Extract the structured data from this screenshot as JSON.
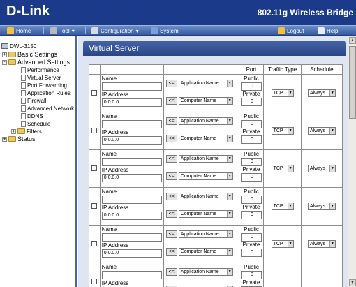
{
  "header": {
    "logo": "D-Link",
    "product": "802.11g Wireless Bridge"
  },
  "menu": {
    "home": "Home",
    "tool": "Tool",
    "configuration": "Configuration",
    "system": "System",
    "logout": "Logout",
    "help": "Help"
  },
  "tree": {
    "root": "DWL-3150",
    "basic": "Basic Settings",
    "advanced": "Advanced Settings",
    "items": [
      "Performance",
      "Virtual Server",
      "Port Forwarding",
      "Application Rules",
      "Firewall",
      "Advanced Network",
      "DDNS",
      "Schedule"
    ],
    "filters": "Filters",
    "status": "Status"
  },
  "main": {
    "title": "Virtual Server",
    "headers": {
      "port": "Port",
      "traffic": "Traffic Type",
      "schedule": "Schedule"
    },
    "labels": {
      "name": "Name",
      "ip": "IP Address",
      "public": "Public",
      "private": "Private",
      "copy": "<<",
      "app_name": "Application Name",
      "computer_name": "Computer Name"
    },
    "rows": [
      {
        "name": "",
        "ip": "0.0.0.0",
        "public": "0",
        "private": "0",
        "traffic": "TCP",
        "schedule": "Always"
      },
      {
        "name": "",
        "ip": "0.0.0.0",
        "public": "0",
        "private": "0",
        "traffic": "TCP",
        "schedule": "Always"
      },
      {
        "name": "",
        "ip": "0.0.0.0",
        "public": "0",
        "private": "0",
        "traffic": "TCP",
        "schedule": "Always"
      },
      {
        "name": "",
        "ip": "0.0.0.0",
        "public": "0",
        "private": "0",
        "traffic": "TCP",
        "schedule": "Always"
      },
      {
        "name": "",
        "ip": "0.0.0.0",
        "public": "0",
        "private": "0",
        "traffic": "TCP",
        "schedule": "Always"
      },
      {
        "name": "",
        "ip": "",
        "public": "0",
        "private": "",
        "traffic": "",
        "schedule": ""
      }
    ]
  }
}
